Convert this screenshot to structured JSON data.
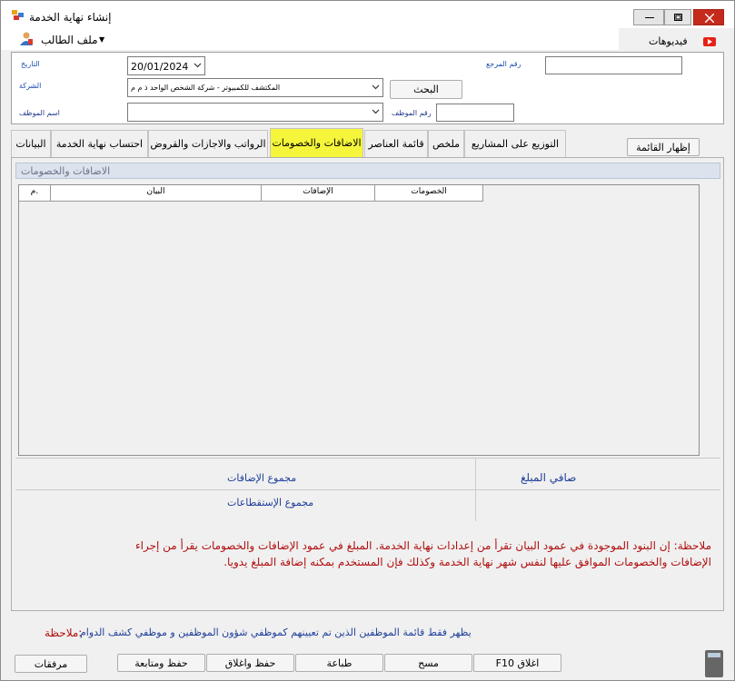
{
  "window": {
    "title": "إنشاء نهاية الخدمة"
  },
  "menu": {
    "student_file": "ملف الطالب",
    "videos": "فيديوهات"
  },
  "header": {
    "date_label": "التاريخ",
    "date_value": "20/01/2024",
    "ref_label": "رقم المرجع",
    "ref_value": "",
    "company_label": "الشركة",
    "company_value": "المكتشف للكمبيوتر - شركة الشخص الواحد ذ م م",
    "search_button": "البحث",
    "employee_name_label": "اسم الموظف",
    "employee_name_value": "",
    "employee_no_label": "رقم الموظف",
    "employee_no_value": ""
  },
  "tabs": [
    {
      "label": "البيانات",
      "active": false
    },
    {
      "label": "احتساب نهاية الخدمة",
      "active": false
    },
    {
      "label": "الرواتب والاجازات والقروض",
      "active": false
    },
    {
      "label": "الاضافات والخصومات",
      "active": true
    },
    {
      "label": "قائمة العناصر",
      "active": false
    },
    {
      "label": "ملخص",
      "active": false
    },
    {
      "label": "التوزيع على المشاريع",
      "active": false
    }
  ],
  "show_list_button": "إظهار القائمة",
  "section": {
    "title": "الاضافات والخصومات"
  },
  "grid": {
    "columns": [
      "م.",
      "البيان",
      "الإضافات",
      "الخصومات"
    ]
  },
  "totals": {
    "additions_total": "مجموع الإضافات",
    "deductions_total": "مجموع الإستقطاعات",
    "net_amount": "صافي المبلغ"
  },
  "note": {
    "line1": "ملاحظة: إن البنود الموجودة في عمود البيان تقرأ من إعدادات نهاية الخدمة. المبلغ في عمود الإضافات والخصومات يقرأ من إجراء",
    "line2": "الإضافات والخصومات الموافق عليها لنفس شهر نهاية الخدمة وكذلك فإن المستخدم بمكنه إضافة المبلغ يدويا."
  },
  "bottom_note": {
    "label": "ملاحظة:",
    "text": "يظهر فقط قائمة الموظفين الذين تم تعيينهم كموظفي شؤون الموظفين و موظفي كشف الدوام"
  },
  "buttons": {
    "attachments": "مرفقات",
    "save_continue": "حفظ ومتابعة",
    "save_close": "حفظ واغلاق",
    "print": "طباعة",
    "clear": "مسح",
    "close": "F10 اغلاق"
  },
  "colors": {
    "active_tab": "#f5f53c",
    "note_red": "#b01010",
    "label_blue": "#1f3f9a",
    "close_button": "#c42b1c"
  }
}
